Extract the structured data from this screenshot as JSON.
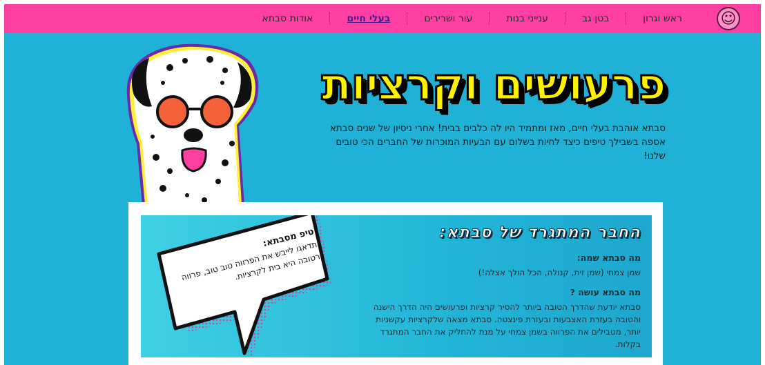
{
  "nav": {
    "items": [
      {
        "label": "ראש וגרון",
        "active": false
      },
      {
        "label": "בטן גב",
        "active": false
      },
      {
        "label": "ענייני בנות",
        "active": false
      },
      {
        "label": "עור ושרירים",
        "active": false
      },
      {
        "label": "בעלי חיים",
        "active": true
      },
      {
        "label": "אודות סבתא",
        "active": false
      }
    ],
    "logo_icon": "grandma-avatar-icon"
  },
  "hero": {
    "title": "פרעושים וקרציות",
    "text": "סבתא אוהבת בעלי חיים, מאז ומתמיד היו לה כלבים בבית! אחרי ניסיון של שנים סבתא אספה בשבילך טיפים כיצד לחיות בשלום עם הבעיות המוכרות של החברים הכי טובים שלנו!"
  },
  "card": {
    "title": "החבר המתגרד של סבתא:",
    "q1": "מה סבתא שמה:",
    "a1": "שמן צמחי (שמן זית, קנולה, הכל הולך אצלה!)",
    "q2": "מה סבתא עושה ?",
    "a2": "סבתא יודעת שהדרך הטובה ביותר להסיר קרציות ופרעושים היה הדרך הישנה והטובה בעזרת האצבעות ובעזרת פינצטה. סבתא מצאה שלקרציות עקשניות יותר, מטבילים את הפרווה בשמן צמחי על מנת להחליק את החבר המתגרד בקלות."
  },
  "tip": {
    "title": "טיפ מסבתא:",
    "text": "תדאגו לייבש את הפרווה טוב טוב, פרווה רטובה היא בית לקרציות."
  },
  "colors": {
    "nav_bg": "#ff3fa4",
    "page_bg": "#1fb1d6",
    "title_yellow": "#fff200",
    "active_nav": "#4b1a8a"
  }
}
